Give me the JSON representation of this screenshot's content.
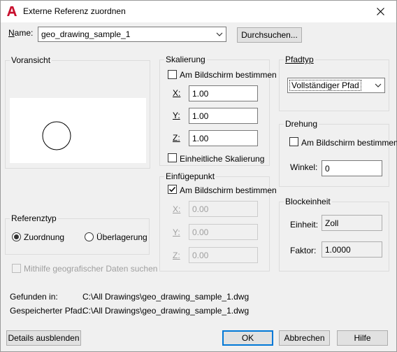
{
  "window": {
    "title": "Externe Referenz zuordnen"
  },
  "name_row": {
    "label": "Name:",
    "selected_value": "geo_drawing_sample_1",
    "browse_button": "Durchsuchen..."
  },
  "preview": {
    "title": "Voransicht"
  },
  "reference_type": {
    "title": "Referenztyp",
    "options": [
      {
        "label": "Zuordnung",
        "selected": true
      },
      {
        "label": "Überlagerung",
        "selected": false
      }
    ]
  },
  "geo_checkbox": {
    "label": "Mithilfe geografischer Daten suchen",
    "checked": false,
    "enabled": false
  },
  "scaling": {
    "title": "Skalierung",
    "on_screen_label": "Am Bildschirm bestimmen",
    "x_label": "X:",
    "x_value": "1.00",
    "y_label": "Y:",
    "y_value": "1.00",
    "z_label": "Z:",
    "z_value": "1.00",
    "uniform_label": "Einheitliche Skalierung"
  },
  "insertion_point": {
    "title": "Einfügepunkt",
    "on_screen_label": "Am Bildschirm bestimmen",
    "on_screen_checked": true,
    "x_label": "X:",
    "x_value": "0.00",
    "y_label": "Y:",
    "y_value": "0.00",
    "z_label": "Z:",
    "z_value": "0.00"
  },
  "path_type": {
    "title": "Pfadtyp",
    "selected_value": "Vollständiger Pfad"
  },
  "rotation": {
    "title": "Drehung",
    "on_screen_label": "Am Bildschirm bestimmen",
    "angle_label": "Winkel:",
    "angle_value": "0"
  },
  "block_unit": {
    "title": "Blockeinheit",
    "unit_label": "Einheit:",
    "unit_value": "Zoll",
    "factor_label": "Faktor:",
    "factor_value": "1.0000"
  },
  "found_in": {
    "label": "Gefunden in:",
    "value": "C:\\All Drawings\\geo_drawing_sample_1.dwg"
  },
  "saved_path": {
    "label": "Gespeicherter Pfad:",
    "value": "C:\\All Drawings\\geo_drawing_sample_1.dwg"
  },
  "buttons": {
    "details": "Details ausblenden",
    "ok": "OK",
    "cancel": "Abbrechen",
    "help": "Hilfe"
  },
  "colors": {
    "accent": "#0078d7",
    "app_icon_red": "#c8102e"
  }
}
